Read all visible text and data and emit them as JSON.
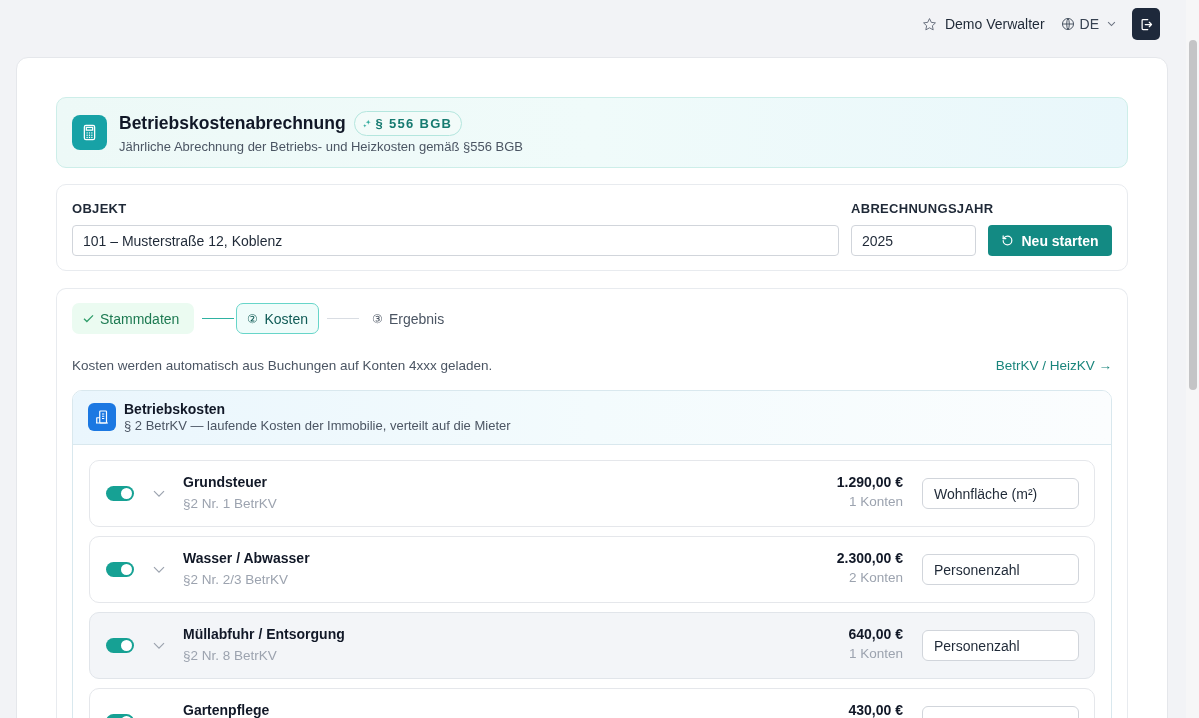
{
  "topbar": {
    "user": "Demo Verwalter",
    "language": "DE"
  },
  "header": {
    "title": "Betriebskostenabrechnung",
    "badge": "§ 556 BGB",
    "subtitle": "Jährliche Abrechnung der Betriebs- und Heizkosten gemäß §556 BGB"
  },
  "object_form": {
    "object_label": "OBJEKT",
    "object_value": "101 – Musterstraße 12, Koblenz",
    "year_label": "ABRECHNUNGSJAHR",
    "year_value": "2025",
    "restart_button": "Neu starten"
  },
  "steps": [
    {
      "label": "Stammdaten",
      "completed": true,
      "selected": false
    },
    {
      "marker": "②",
      "label": "Kosten",
      "completed": false,
      "selected": true
    },
    {
      "marker": "③",
      "label": "Ergebnis",
      "completed": false,
      "selected": false
    }
  ],
  "info_text": "Kosten werden automatisch aus Buchungen auf Konten 4xxx geladen.",
  "link": "BetrKV / HeizKV →",
  "section": {
    "title": "Betriebskosten",
    "subtitle": "§ 2 BetrKV — laufende Kosten der Immobilie, verteilt auf die Mieter",
    "items": [
      {
        "name": "Grundsteuer",
        "reference": "§2 Nr. 1 BetrKV",
        "on": true,
        "expanded": false,
        "highlighted": false,
        "amount": "1.290,00 €",
        "accounts": "1 Konten",
        "distribution": "Wohnfläche (m²)"
      },
      {
        "name": "Wasser / Abwasser",
        "reference": "§2 Nr. 2/3 BetrKV",
        "on": true,
        "expanded": false,
        "highlighted": false,
        "amount": "2.300,00 €",
        "accounts": "2 Konten",
        "distribution": "Personenzahl"
      },
      {
        "name": "Müllabfuhr / Entsorgung",
        "reference": "§2 Nr. 8 BetrKV",
        "on": true,
        "expanded": false,
        "highlighted": true,
        "amount": "640,00 €",
        "accounts": "1 Konten",
        "distribution": "Personenzahl"
      },
      {
        "name": "Gartenpflege",
        "on": true,
        "expanded": false,
        "highlighted": false,
        "amount": "430,00 €"
      }
    ]
  }
}
